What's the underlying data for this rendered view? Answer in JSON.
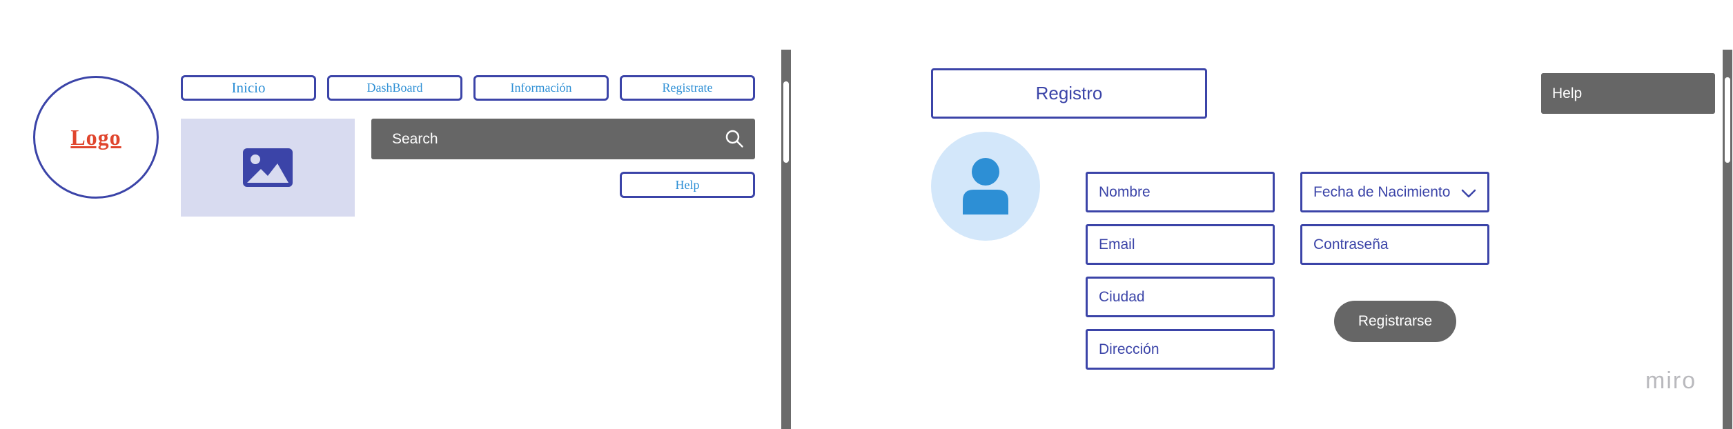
{
  "left_frame": {
    "logo": "Logo",
    "nav": [
      {
        "label": "Inicio"
      },
      {
        "label": "DashBoard"
      },
      {
        "label": "Información"
      },
      {
        "label": "Registrate"
      }
    ],
    "search": {
      "label": "Search",
      "icon": "search-icon"
    },
    "help": "Help",
    "image_icon": "image-icon"
  },
  "right_frame": {
    "title": "Registro",
    "help": "Help",
    "avatar_icon": "user-icon",
    "fields": {
      "nombre": "Nombre",
      "fecha": "Fecha de Nacimiento",
      "email": "Email",
      "contrasena": "Contraseña",
      "ciudad": "Ciudad",
      "direccion": "Dirección"
    },
    "submit": "Registrarse"
  },
  "watermark": "miro",
  "colors": {
    "accent": "#3b44a8",
    "link": "#2d8fd5",
    "logo": "#e0452d",
    "dark_button": "#666666",
    "avatar_bg": "#d3e7fa",
    "avatar_fg": "#2d8fd5",
    "image_bg": "#d8dbf0"
  }
}
